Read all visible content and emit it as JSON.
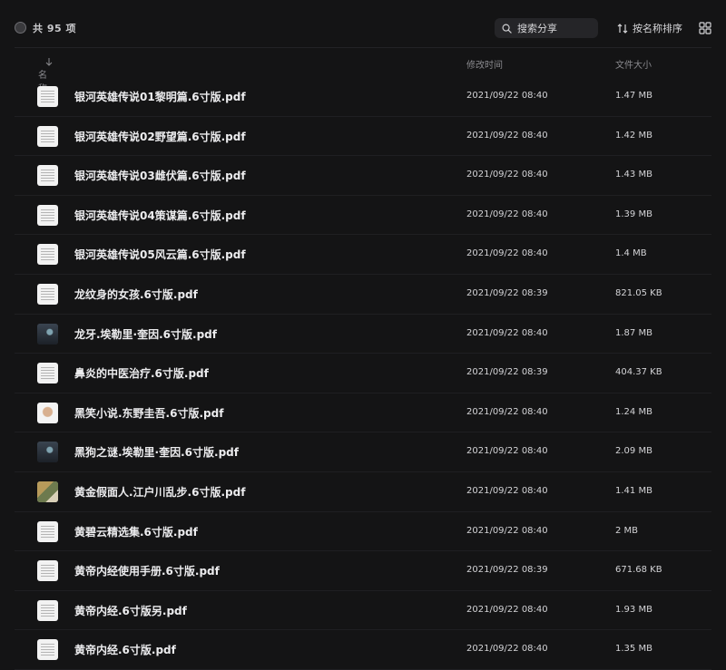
{
  "toolbar": {
    "count_label": "共 95 项",
    "search_placeholder": "搜索分享",
    "sort_label": "按名称排序"
  },
  "columns": {
    "name": "名称",
    "time": "修改时间",
    "size": "文件大小"
  },
  "files": [
    {
      "name": "银河英雄传说01黎明篇.6寸版.pdf",
      "time": "2021/09/22 08:40",
      "size": "1.47 MB",
      "thumb": "doc"
    },
    {
      "name": "银河英雄传说02野望篇.6寸版.pdf",
      "time": "2021/09/22 08:40",
      "size": "1.42 MB",
      "thumb": "doc"
    },
    {
      "name": "银河英雄传说03雌伏篇.6寸版.pdf",
      "time": "2021/09/22 08:40",
      "size": "1.43 MB",
      "thumb": "doc"
    },
    {
      "name": "银河英雄传说04策谋篇.6寸版.pdf",
      "time": "2021/09/22 08:40",
      "size": "1.39 MB",
      "thumb": "doc"
    },
    {
      "name": "银河英雄传说05风云篇.6寸版.pdf",
      "time": "2021/09/22 08:40",
      "size": "1.4 MB",
      "thumb": "doc"
    },
    {
      "name": "龙纹身的女孩.6寸版.pdf",
      "time": "2021/09/22 08:39",
      "size": "821.05 KB",
      "thumb": "doc"
    },
    {
      "name": "龙牙.埃勒里·奎因.6寸版.pdf",
      "time": "2021/09/22 08:40",
      "size": "1.87 MB",
      "thumb": "dark"
    },
    {
      "name": "鼻炎的中医治疗.6寸版.pdf",
      "time": "2021/09/22 08:39",
      "size": "404.37 KB",
      "thumb": "doc"
    },
    {
      "name": "黑笑小说.东野圭吾.6寸版.pdf",
      "time": "2021/09/22 08:40",
      "size": "1.24 MB",
      "thumb": "face"
    },
    {
      "name": "黑狗之谜.埃勒里·奎因.6寸版.pdf",
      "time": "2021/09/22 08:40",
      "size": "2.09 MB",
      "thumb": "dark"
    },
    {
      "name": "黄金假面人.江户川乱步.6寸版.pdf",
      "time": "2021/09/22 08:40",
      "size": "1.41 MB",
      "thumb": "photo"
    },
    {
      "name": "黄碧云精选集.6寸版.pdf",
      "time": "2021/09/22 08:40",
      "size": "2 MB",
      "thumb": "doc"
    },
    {
      "name": "黄帝内经使用手册.6寸版.pdf",
      "time": "2021/09/22 08:39",
      "size": "671.68 KB",
      "thumb": "doc"
    },
    {
      "name": "黄帝内经.6寸版另.pdf",
      "time": "2021/09/22 08:40",
      "size": "1.93 MB",
      "thumb": "doc"
    },
    {
      "name": "黄帝内经.6寸版.pdf",
      "time": "2021/09/22 08:40",
      "size": "1.35 MB",
      "thumb": "doc"
    }
  ]
}
